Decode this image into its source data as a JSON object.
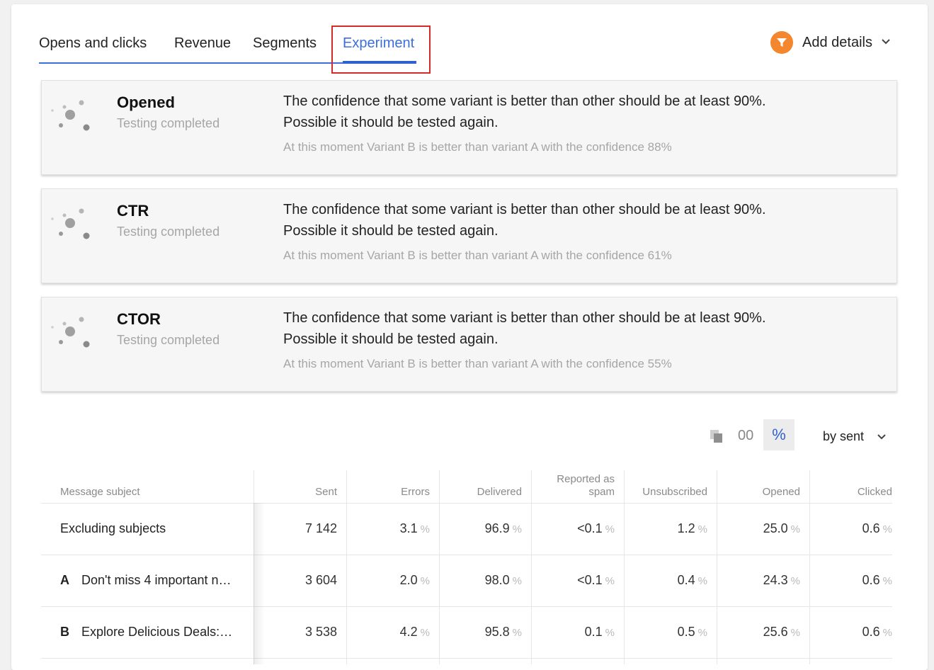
{
  "tabs": [
    {
      "label": "Opens and clicks",
      "active": false
    },
    {
      "label": "Revenue",
      "active": false
    },
    {
      "label": "Segments",
      "active": false
    },
    {
      "label": "Experiment",
      "active": true
    }
  ],
  "add_details": {
    "label": "Add details",
    "icon": "funnel-icon",
    "accent": "#f4862d"
  },
  "results": [
    {
      "metric": "Opened",
      "status": "Testing completed",
      "line1": "The confidence that some variant is better than other should be at least 90%.",
      "line2": "Possible it should be tested again.",
      "note": "At this moment Variant B is better than variant A with the confidence 88%"
    },
    {
      "metric": "CTR",
      "status": "Testing completed",
      "line1": "The confidence that some variant is better than other should be at least 90%.",
      "line2": "Possible it should be tested again.",
      "note": "At this moment Variant B is better than variant A with the confidence 61%"
    },
    {
      "metric": "CTOR",
      "status": "Testing completed",
      "line1": "The confidence that some variant is better than other should be at least 90%.",
      "line2": "Possible it should be tested again.",
      "note": "At this moment Variant B is better than variant A with the confidence 55%"
    }
  ],
  "controls": {
    "abs_label": "00",
    "pct_label": "%",
    "sort_label": "by sent"
  },
  "table": {
    "headers": {
      "subject": "Message subject",
      "sent": "Sent",
      "errors": "Errors",
      "delivered": "Delivered",
      "spam_line1": "Reported as",
      "spam_line2": "spam",
      "unsubscribed": "Unsubscribed",
      "opened": "Opened",
      "clicked": "Clicked"
    },
    "unit": "%",
    "rows": [
      {
        "letter": "",
        "subject": "Excluding subjects",
        "sent": "7 142",
        "errors": "3.1",
        "delivered": "96.9",
        "spam": "<0.1",
        "unsubscribed": "1.2",
        "opened": "25.0",
        "clicked": "0.6"
      },
      {
        "letter": "A",
        "subject": "Don't miss 4 important ne...",
        "sent": "3 604",
        "errors": "2.0",
        "delivered": "98.0",
        "spam": "<0.1",
        "unsubscribed": "0.4",
        "opened": "24.3",
        "clicked": "0.6"
      },
      {
        "letter": "B",
        "subject": "Explore Delicious Deals: ...",
        "sent": "3 538",
        "errors": "4.2",
        "delivered": "95.8",
        "spam": "0.1",
        "unsubscribed": "0.5",
        "opened": "25.6",
        "clicked": "0.6"
      }
    ]
  }
}
